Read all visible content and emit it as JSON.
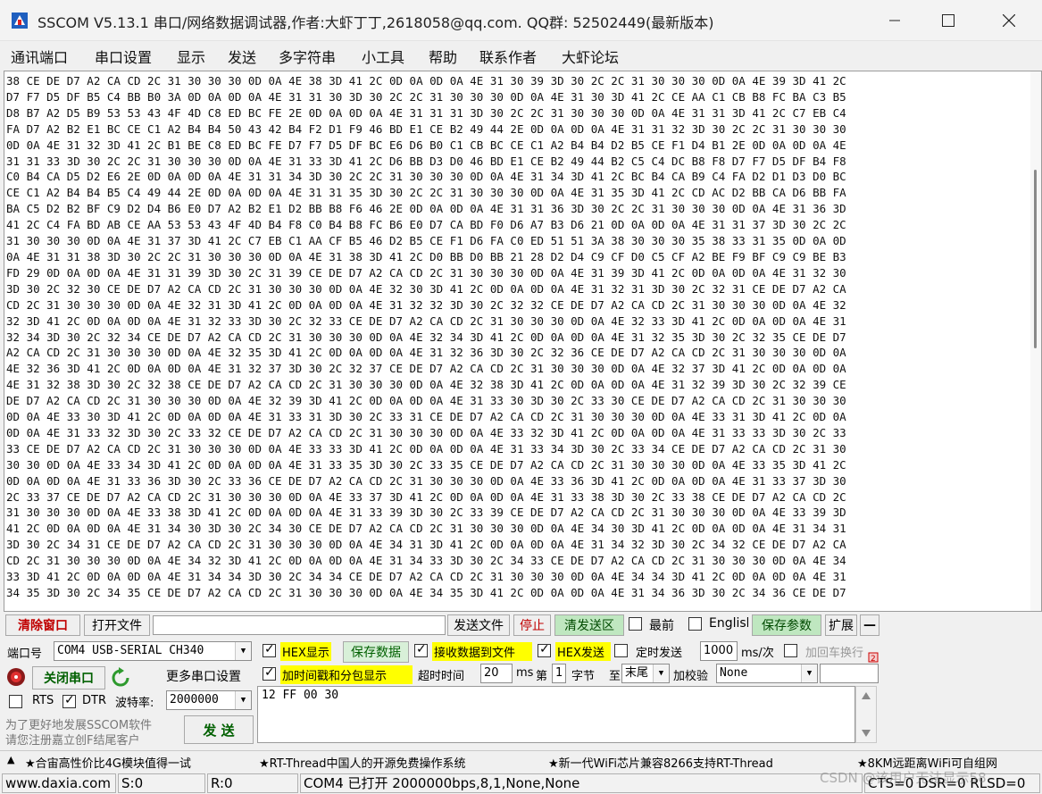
{
  "window": {
    "title": "SSCOM V5.13.1 串口/网络数据调试器,作者:大虾丁丁,2618058@qq.com. QQ群: 52502449(最新版本)"
  },
  "menu": [
    "通讯端口",
    "串口设置",
    "显示",
    "发送",
    "多字符串",
    "小工具",
    "帮助",
    "联系作者",
    "大虾论坛"
  ],
  "receive": {
    "lines": [
      "38 CE DE D7 A2 CA CD 2C 31 30 30 30 0D 0A 4E 38 3D 41 2C 0D 0A 0D 0A 4E 31 30 39 3D 30 2C 2C 31 30 30 30 0D 0A 4E 39 3D 41 2C",
      "D7 F7 D5 DF B5 C4 BB B0 3A 0D 0A 0D 0A 4E 31 31 30 3D 30 2C 2C 31 30 30 30 0D 0A 4E 31 30 3D 41 2C CE AA C1 CB B8 FC BA C3 B5",
      "D8 B7 A2 D5 B9 53 53 43 4F 4D C8 ED BC FE 2E 0D 0A 0D 0A 4E 31 31 31 3D 30 2C 2C 31 30 30 30 0D 0A 4E 31 31 3D 41 2C C7 EB C4",
      "FA D7 A2 B2 E1 BC CE C1 A2 B4 B4 50 43 42 B4 F2 D1 F9 46 BD E1 CE B2 49 44 2E 0D 0A 0D 0A 4E 31 31 32 3D 30 2C 2C 31 30 30 30",
      "0D 0A 4E 31 32 3D 41 2C B1 BE C8 ED BC FE D7 F7 D5 DF BC E6 D6 B0 C1 CB BC CE C1 A2 B4 B4 D2 B5 CE F1 D4 B1 2E 0D 0A 0D 0A 4E",
      "31 31 33 3D 30 2C 2C 31 30 30 30 0D 0A 4E 31 33 3D 41 2C D6 BB D3 D0 46 BD E1 CE B2 49 44 B2 C5 C4 DC B8 F8 D7 F7 D5 DF B4 F8",
      "C0 B4 CA D5 D2 E6 2E 0D 0A 0D 0A 4E 31 31 34 3D 30 2C 2C 31 30 30 30 0D 0A 4E 31 34 3D 41 2C BC B4 CA B9 C4 FA D2 D1 D3 D0 BC",
      "CE C1 A2 B4 B4 B5 C4 49 44 2E 0D 0A 0D 0A 4E 31 31 35 3D 30 2C 2C 31 30 30 30 0D 0A 4E 31 35 3D 41 2C CD AC D2 BB CA D6 BB FA",
      "BA C5 D2 B2 BF C9 D2 D4 B6 E0 D7 A2 B2 E1 D2 BB B8 F6 46 2E 0D 0A 0D 0A 4E 31 31 36 3D 30 2C 2C 31 30 30 30 0D 0A 4E 31 36 3D",
      "41 2C C4 FA BD AB CE AA 53 53 43 4F 4D B4 F8 C0 B4 B8 FC B6 E0 D7 CA BD F0 D6 A7 B3 D6 21 0D 0A 0D 0A 4E 31 31 37 3D 30 2C 2C",
      "31 30 30 30 0D 0A 4E 31 37 3D 41 2C C7 EB C1 AA CF B5 46 D2 B5 CE F1 D6 FA C0 ED 51 51 3A 38 30 30 30 35 38 33 31 35 0D 0A 0D",
      "0A 4E 31 31 38 3D 30 2C 2C 31 30 30 30 0D 0A 4E 31 38 3D 41 2C D0 BB D0 BB 21 28 D2 D4 C9 CF D0 C5 CF A2 BE F9 BF C9 C9 BE B3",
      "FD 29 0D 0A 0D 0A 4E 31 31 39 3D 30 2C 31 39 CE DE D7 A2 CA CD 2C 31 30 30 30 0D 0A 4E 31 39 3D 41 2C 0D 0A 0D 0A 4E 31 32 30",
      "3D 30 2C 32 30 CE DE D7 A2 CA CD 2C 31 30 30 30 0D 0A 4E 32 30 3D 41 2C 0D 0A 0D 0A 4E 31 32 31 3D 30 2C 32 31 CE DE D7 A2 CA",
      "CD 2C 31 30 30 30 0D 0A 4E 32 31 3D 41 2C 0D 0A 0D 0A 4E 31 32 32 3D 30 2C 32 32 CE DE D7 A2 CA CD 2C 31 30 30 30 0D 0A 4E 32",
      "32 3D 41 2C 0D 0A 0D 0A 4E 31 32 33 3D 30 2C 32 33 CE DE D7 A2 CA CD 2C 31 30 30 30 0D 0A 4E 32 33 3D 41 2C 0D 0A 0D 0A 4E 31",
      "32 34 3D 30 2C 32 34 CE DE D7 A2 CA CD 2C 31 30 30 30 0D 0A 4E 32 34 3D 41 2C 0D 0A 0D 0A 4E 31 32 35 3D 30 2C 32 35 CE DE D7",
      "A2 CA CD 2C 31 30 30 30 0D 0A 4E 32 35 3D 41 2C 0D 0A 0D 0A 4E 31 32 36 3D 30 2C 32 36 CE DE D7 A2 CA CD 2C 31 30 30 30 0D 0A",
      "4E 32 36 3D 41 2C 0D 0A 0D 0A 4E 31 32 37 3D 30 2C 32 37 CE DE D7 A2 CA CD 2C 31 30 30 30 0D 0A 4E 32 37 3D 41 2C 0D 0A 0D 0A",
      "4E 31 32 38 3D 30 2C 32 38 CE DE D7 A2 CA CD 2C 31 30 30 30 0D 0A 4E 32 38 3D 41 2C 0D 0A 0D 0A 4E 31 32 39 3D 30 2C 32 39 CE",
      "DE D7 A2 CA CD 2C 31 30 30 30 0D 0A 4E 32 39 3D 41 2C 0D 0A 0D 0A 4E 31 33 30 3D 30 2C 33 30 CE DE D7 A2 CA CD 2C 31 30 30 30",
      "0D 0A 4E 33 30 3D 41 2C 0D 0A 0D 0A 4E 31 33 31 3D 30 2C 33 31 CE DE D7 A2 CA CD 2C 31 30 30 30 0D 0A 4E 33 31 3D 41 2C 0D 0A",
      "0D 0A 4E 31 33 32 3D 30 2C 33 32 CE DE D7 A2 CA CD 2C 31 30 30 30 0D 0A 4E 33 32 3D 41 2C 0D 0A 0D 0A 4E 31 33 33 3D 30 2C 33",
      "33 CE DE D7 A2 CA CD 2C 31 30 30 30 0D 0A 4E 33 33 3D 41 2C 0D 0A 0D 0A 4E 31 33 34 3D 30 2C 33 34 CE DE D7 A2 CA CD 2C 31 30",
      "30 30 0D 0A 4E 33 34 3D 41 2C 0D 0A 0D 0A 4E 31 33 35 3D 30 2C 33 35 CE DE D7 A2 CA CD 2C 31 30 30 30 0D 0A 4E 33 35 3D 41 2C",
      "0D 0A 0D 0A 4E 31 33 36 3D 30 2C 33 36 CE DE D7 A2 CA CD 2C 31 30 30 30 0D 0A 4E 33 36 3D 41 2C 0D 0A 0D 0A 4E 31 33 37 3D 30",
      "2C 33 37 CE DE D7 A2 CA CD 2C 31 30 30 30 0D 0A 4E 33 37 3D 41 2C 0D 0A 0D 0A 4E 31 33 38 3D 30 2C 33 38 CE DE D7 A2 CA CD 2C",
      "31 30 30 30 0D 0A 4E 33 38 3D 41 2C 0D 0A 0D 0A 4E 31 33 39 3D 30 2C 33 39 CE DE D7 A2 CA CD 2C 31 30 30 30 0D 0A 4E 33 39 3D",
      "41 2C 0D 0A 0D 0A 4E 31 34 30 3D 30 2C 34 30 CE DE D7 A2 CA CD 2C 31 30 30 30 0D 0A 4E 34 30 3D 41 2C 0D 0A 0D 0A 4E 31 34 31",
      "3D 30 2C 34 31 CE DE D7 A2 CA CD 2C 31 30 30 30 0D 0A 4E 34 31 3D 41 2C 0D 0A 0D 0A 4E 31 34 32 3D 30 2C 34 32 CE DE D7 A2 CA",
      "CD 2C 31 30 30 30 0D 0A 4E 34 32 3D 41 2C 0D 0A 0D 0A 4E 31 34 33 3D 30 2C 34 33 CE DE D7 A2 CA CD 2C 31 30 30 30 0D 0A 4E 34",
      "33 3D 41 2C 0D 0A 0D 0A 4E 31 34 34 3D 30 2C 34 34 CE DE D7 A2 CA CD 2C 31 30 30 30 0D 0A 4E 34 34 3D 41 2C 0D 0A 0D 0A 4E 31",
      "34 35 3D 30 2C 34 35 CE DE D7 A2 CA CD 2C 31 30 30 30 0D 0A 4E 34 35 3D 41 2C 0D 0A 0D 0A 4E 31 34 36 3D 30 2C 34 36 CE DE D7"
    ]
  },
  "toolbar": {
    "clear": "清除窗口",
    "open_file": "打开文件",
    "send_file": "发送文件",
    "stop": "停止",
    "clear_send": "清发送区",
    "top_most": "最前",
    "english": "English",
    "save_params": "保存参数",
    "expand": "扩展",
    "collapse": "—"
  },
  "port": {
    "label": "端口号",
    "value": "COM4 USB-SERIAL CH340",
    "close_btn": "关闭串口",
    "more_settings": "更多串口设置",
    "rts": "RTS",
    "dtr": "DTR",
    "baud_label": "波特率:",
    "baud_value": "2000000"
  },
  "options": {
    "hex_display": "HEX显示",
    "save_data": "保存数据",
    "recv_to_file": "接收数据到文件",
    "hex_send": "HEX发送",
    "timed_send": "定时发送",
    "interval_value": "1000",
    "interval_unit": "ms/次",
    "add_crlf": "加回车换行",
    "add_timestamp": "加时间戳和分包显示",
    "timeout_label": "超时时间",
    "timeout_value": "20",
    "timeout_unit": "ms",
    "byte_prefix": "第",
    "byte_index": "1",
    "byte_label": "字节",
    "to_label": "至",
    "to_value": "末尾",
    "checksum_label": "加校验",
    "checksum_value": "None"
  },
  "promo": {
    "text1": "为了更好地发展SSCOM软件",
    "text2": "请您注册嘉立创F结尾客户"
  },
  "send": {
    "content": "12 FF 00 30",
    "button": "发 送"
  },
  "ads": [
    "★合宙高性价比4G模块值得一试",
    "★RT-Thread中国人的开源免费操作系统",
    "★新一代WiFi芯片兼容8266支持RT-Thread",
    "★8KM远距离WiFi可自组网"
  ],
  "status": {
    "site": "www.daxia.com",
    "s_count": "S:0",
    "r_count": "R:0",
    "port_info": "COM4 已打开  2000000bps,8,1,None,None",
    "lines": "CTS=0 DSR=0 RLSD=0"
  },
  "watermark": "CSDN @该用户无法显示58"
}
